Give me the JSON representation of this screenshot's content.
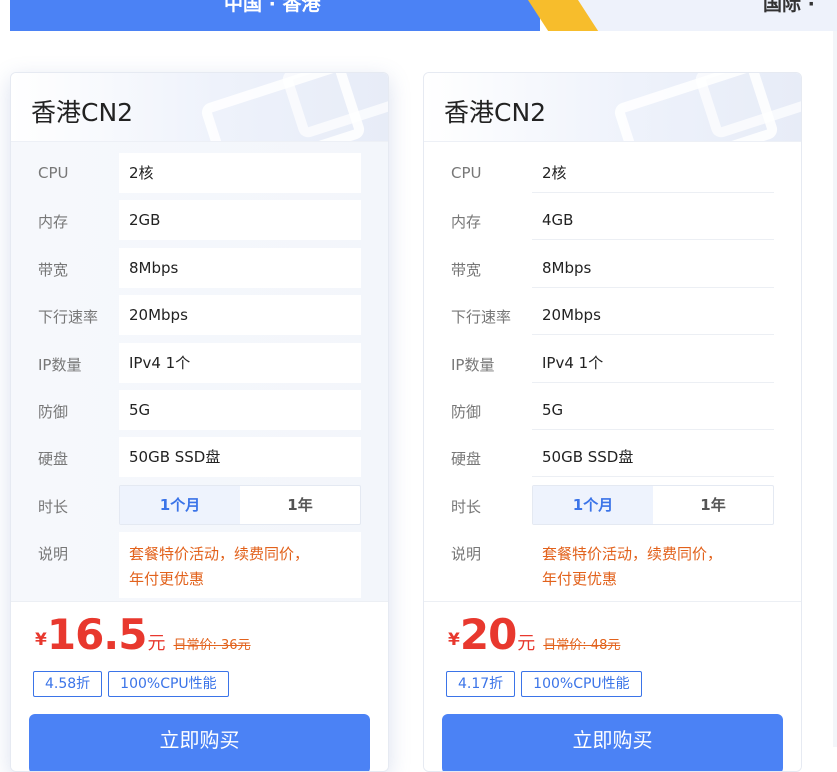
{
  "tabs": {
    "left_label": "中国 · 香港",
    "right_label": "国际 ·"
  },
  "colors": {
    "accent": "#4b82f5",
    "highlight": "#f7bd2c",
    "price": "#e8382e",
    "note": "#e2621c"
  },
  "cards": [
    {
      "title": "香港CN2",
      "specs": [
        {
          "label": "CPU",
          "value": "2核"
        },
        {
          "label": "内存",
          "value": "2GB"
        },
        {
          "label": "带宽",
          "value": "8Mbps"
        },
        {
          "label": "下行速率",
          "value": "20Mbps"
        },
        {
          "label": "IP数量",
          "value": "IPv4 1个"
        },
        {
          "label": "防御",
          "value": "5G"
        },
        {
          "label": "硬盘",
          "value": "50GB SSD盘"
        }
      ],
      "duration_label": "时长",
      "duration_options": [
        "1个月",
        "1年"
      ],
      "duration_selected": "1个月",
      "desc_label": "说明",
      "desc_line1": "套餐特价活动，续费同价，",
      "desc_line2": "年付更优惠",
      "currency": "¥",
      "price": "16.5",
      "unit": "元",
      "original_price": "日常价: 36元",
      "tags": [
        "4.58折",
        "100%CPU性能"
      ],
      "buy_label": "立即购买"
    },
    {
      "title": "香港CN2",
      "specs": [
        {
          "label": "CPU",
          "value": "2核"
        },
        {
          "label": "内存",
          "value": "4GB"
        },
        {
          "label": "带宽",
          "value": "8Mbps"
        },
        {
          "label": "下行速率",
          "value": "20Mbps"
        },
        {
          "label": "IP数量",
          "value": "IPv4 1个"
        },
        {
          "label": "防御",
          "value": "5G"
        },
        {
          "label": "硬盘",
          "value": "50GB SSD盘"
        }
      ],
      "duration_label": "时长",
      "duration_options": [
        "1个月",
        "1年"
      ],
      "duration_selected": "1个月",
      "desc_label": "说明",
      "desc_line1": "套餐特价活动，续费同价，",
      "desc_line2": "年付更优惠",
      "currency": "¥",
      "price": "20",
      "unit": "元",
      "original_price": "日常价: 48元",
      "tags": [
        "4.17折",
        "100%CPU性能"
      ],
      "buy_label": "立即购买"
    }
  ]
}
